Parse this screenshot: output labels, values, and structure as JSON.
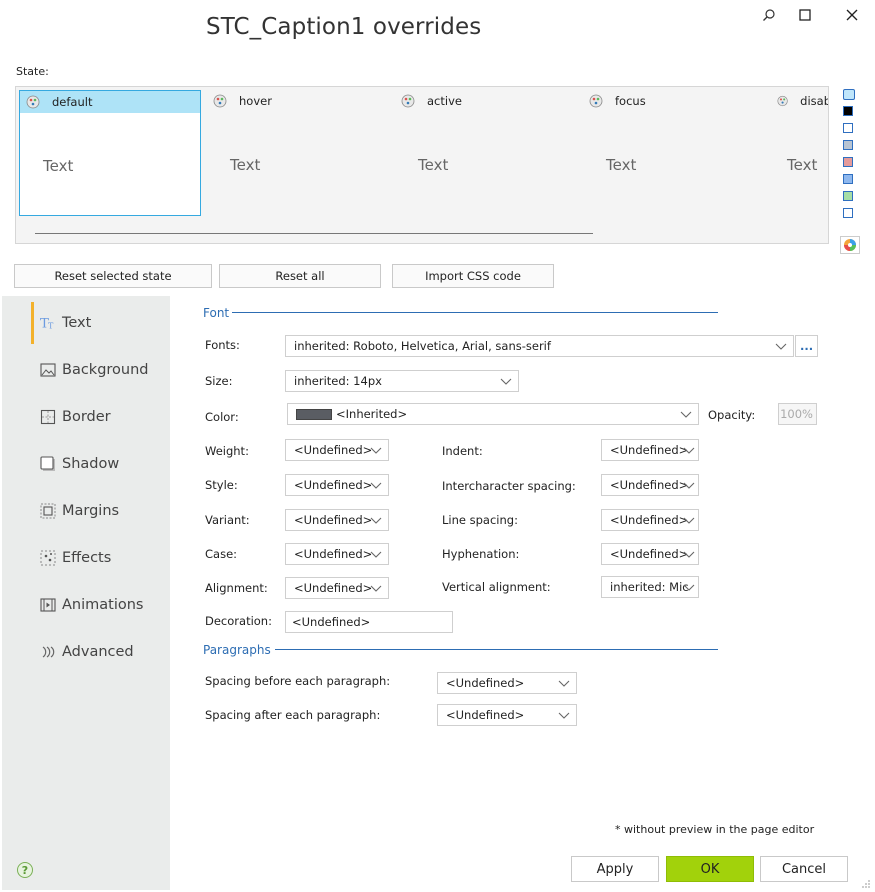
{
  "window": {
    "title": "STC_Caption1 overrides"
  },
  "states": {
    "label": "State:",
    "items": [
      {
        "name": "default",
        "sample": "Text"
      },
      {
        "name": "hover",
        "sample": "Text"
      },
      {
        "name": "active",
        "sample": "Text"
      },
      {
        "name": "focus",
        "sample": "Text"
      },
      {
        "name": "disab",
        "sample": "Text"
      }
    ],
    "selected": "default",
    "swatch_colors": [
      "#bfe6fb",
      "#000000",
      "#ffffff",
      "#b8c4d2",
      "#e59b9b",
      "#8fb8ee",
      "#a6dea6",
      "#ffffff"
    ]
  },
  "toolbar": {
    "reset_selected": "Reset selected state",
    "reset_all": "Reset all",
    "import_css": "Import CSS code"
  },
  "sidebar": {
    "items": [
      {
        "label": "Text",
        "icon": "text-icon"
      },
      {
        "label": "Background",
        "icon": "image-icon"
      },
      {
        "label": "Border",
        "icon": "border-icon"
      },
      {
        "label": "Shadow",
        "icon": "shadow-icon"
      },
      {
        "label": "Margins",
        "icon": "margins-icon"
      },
      {
        "label": "Effects",
        "icon": "effects-icon"
      },
      {
        "label": "Animations",
        "icon": "animations-icon"
      },
      {
        "label": "Advanced",
        "icon": "advanced-icon"
      }
    ],
    "selected": "Text"
  },
  "font": {
    "section": "Font",
    "fonts_label": "Fonts:",
    "fonts_value": "inherited: Roboto, Helvetica, Arial, sans-serif",
    "more_label": "...",
    "size_label": "Size:",
    "size_value": "inherited: 14px",
    "color_label": "Color:",
    "color_value": "<Inherited>",
    "color_swatch": "#5a5d63",
    "opacity_label": "Opacity:",
    "opacity_value": "100%",
    "weight_label": "Weight:",
    "weight_value": "<Undefined>",
    "style_label": "Style:",
    "style_value": "<Undefined>",
    "variant_label": "Variant:",
    "variant_value": "<Undefined>",
    "case_label": "Case:",
    "case_value": "<Undefined>",
    "alignment_label": "Alignment:",
    "alignment_value": "<Undefined>",
    "decoration_label": "Decoration:",
    "decoration_value": "<Undefined>",
    "indent_label": "Indent:",
    "indent_value": "<Undefined>",
    "interchar_label": "Intercharacter spacing:",
    "interchar_value": "<Undefined>",
    "linespacing_label": "Line spacing:",
    "linespacing_value": "<Undefined>",
    "hyphenation_label": "Hyphenation:",
    "hyphenation_value": "<Undefined>",
    "valign_label": "Vertical alignment:",
    "valign_value": "inherited: Mic"
  },
  "paragraphs": {
    "section": "Paragraphs",
    "before_label": "Spacing before each paragraph:",
    "before_value": "<Undefined>",
    "after_label": "Spacing after each paragraph:",
    "after_value": "<Undefined>"
  },
  "footer": {
    "note": "* without preview in the page editor",
    "apply": "Apply",
    "ok": "OK",
    "cancel": "Cancel"
  }
}
